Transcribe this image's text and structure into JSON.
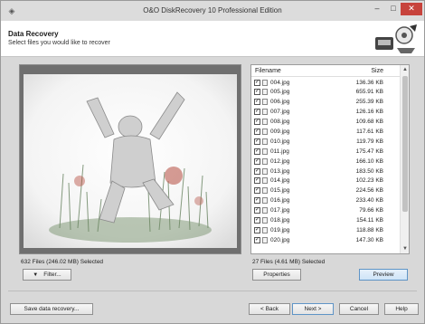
{
  "window": {
    "title": "O&O DiskRecovery 10 Professional Edition",
    "controls": {
      "minimize": "–",
      "maximize": "□",
      "close": "✕"
    }
  },
  "header": {
    "title": "Data Recovery",
    "subtitle": "Select files you would like to recover"
  },
  "file_list": {
    "columns": {
      "name": "Filename",
      "size": "Size"
    },
    "rows": [
      {
        "name": "004.jpg",
        "size": "136.36 KB",
        "checked": true
      },
      {
        "name": "005.jpg",
        "size": "655.91 KB",
        "checked": true
      },
      {
        "name": "006.jpg",
        "size": "255.39 KB",
        "checked": true
      },
      {
        "name": "007.jpg",
        "size": "126.16 KB",
        "checked": true
      },
      {
        "name": "008.jpg",
        "size": "109.68 KB",
        "checked": true
      },
      {
        "name": "009.jpg",
        "size": "117.61 KB",
        "checked": true
      },
      {
        "name": "010.jpg",
        "size": "119.79 KB",
        "checked": true
      },
      {
        "name": "011.jpg",
        "size": "175.47 KB",
        "checked": true
      },
      {
        "name": "012.jpg",
        "size": "166.10 KB",
        "checked": true
      },
      {
        "name": "013.jpg",
        "size": "183.50 KB",
        "checked": true
      },
      {
        "name": "014.jpg",
        "size": "102.23 KB",
        "checked": true
      },
      {
        "name": "015.jpg",
        "size": "224.56 KB",
        "checked": true
      },
      {
        "name": "016.jpg",
        "size": "233.40 KB",
        "checked": true
      },
      {
        "name": "017.jpg",
        "size": "79.66 KB",
        "checked": true
      },
      {
        "name": "018.jpg",
        "size": "154.11 KB",
        "checked": true
      },
      {
        "name": "019.jpg",
        "size": "118.88 KB",
        "checked": true
      },
      {
        "name": "020.jpg",
        "size": "147.30 KB",
        "checked": true
      }
    ]
  },
  "status": {
    "left": "632 Files (246.02 MB) Selected",
    "right": "27 Files (4.61 MB) Selected"
  },
  "buttons": {
    "filter": "Filter...",
    "properties": "Properties",
    "preview": "Preview",
    "save": "Save data recovery...",
    "back": "< Back",
    "next": "Next >",
    "cancel": "Cancel",
    "help": "Help"
  },
  "icons": {
    "app": "app-icon",
    "checkbox": "checkbox-icon",
    "file": "file-icon",
    "dropdown": "dropdown-arrow-icon",
    "scroll_up": "scroll-up-icon",
    "scroll_down": "scroll-down-icon"
  },
  "colors": {
    "close_button": "#c7433c",
    "accent": "#5f94c6"
  }
}
